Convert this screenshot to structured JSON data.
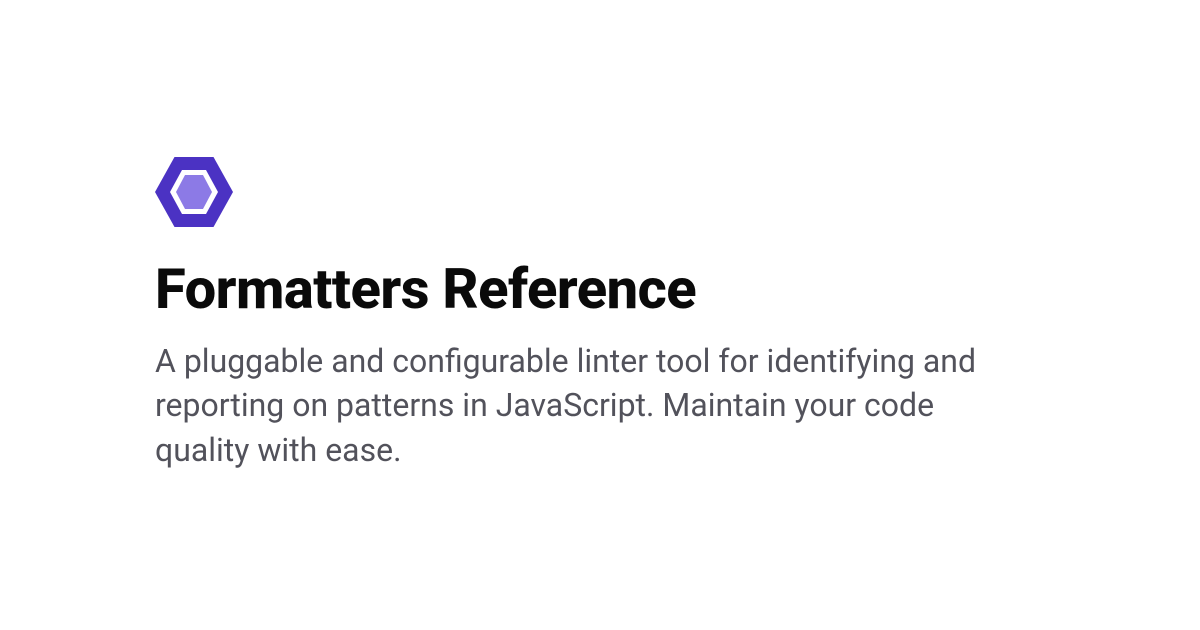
{
  "logo": {
    "name": "eslint-logo",
    "color_outer": "#4B32C3",
    "color_inner": "#8C7AE6"
  },
  "title": "Formatters Reference",
  "description": "A pluggable and configurable linter tool for identifying and reporting on patterns in JavaScript. Maintain your code quality with ease."
}
